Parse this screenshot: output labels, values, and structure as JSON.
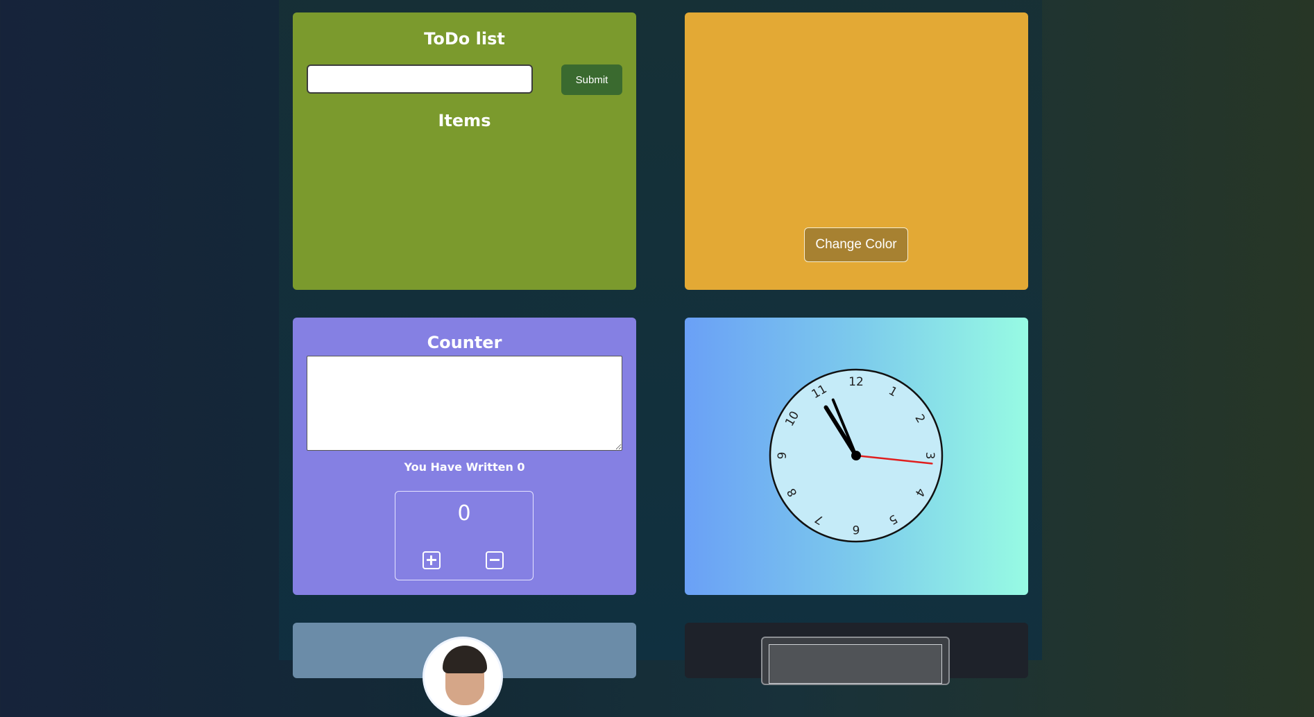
{
  "todo": {
    "title": "ToDo list",
    "input_value": "",
    "input_placeholder": "",
    "submit_label": "Submit",
    "items_title": "Items",
    "items": []
  },
  "color_widget": {
    "background": "#e3a935",
    "button_label": "Change Color"
  },
  "counter": {
    "title": "Counter",
    "textarea_value": "",
    "written_text": "You Have Written 0",
    "count": "0",
    "increment_icon": "plus-square-icon",
    "decrement_icon": "minus-square-icon"
  },
  "clock": {
    "numerals": [
      "12",
      "1",
      "2",
      "3",
      "4",
      "5",
      "6",
      "7",
      "8",
      "9",
      "10",
      "11"
    ],
    "time": {
      "hour": 10,
      "minute": 56,
      "second": 16
    }
  },
  "colors": {
    "todo_card": "#7b9a2d",
    "submit_button": "#3a6a2f",
    "counter_card": "#8580e3",
    "clock_gradient_start": "#6aa0f6",
    "clock_gradient_end": "#97fbe3",
    "profile_card": "#6b8ca8",
    "dark_card": "#1e222a"
  }
}
